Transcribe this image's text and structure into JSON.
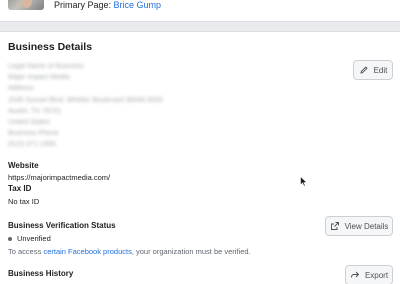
{
  "top": {
    "primary_page_label": "Primary Page:",
    "primary_page_name": "Brice Gump"
  },
  "business_details": {
    "title": "Business Details",
    "edit_label": "Edit",
    "redacted_lines": [
      "Legal Name of Business",
      "Major Impact Media",
      "Address",
      "2035 Sunset Blvd, Whittier Boulevard 90040 8000",
      "Austin, TX 78701",
      "United States",
      "Business Phone",
      "(512) 371-1665"
    ],
    "website_label": "Website",
    "website_value": "https://majorimpactmedia.com/",
    "tax_id_label": "Tax ID",
    "tax_id_value": "No tax ID"
  },
  "verification": {
    "title": "Business Verification Status",
    "status": "Unverified",
    "view_details_label": "View Details",
    "note_prefix": "To access ",
    "note_link": "certain Facebook products",
    "note_suffix": ", your organization must be verified."
  },
  "history": {
    "title": "Business History",
    "export_label": "Export"
  },
  "icons": {
    "edit": "pencil-icon",
    "view_details": "external-link-icon",
    "export": "export-icon"
  },
  "colors": {
    "link": "#216fdb",
    "background": "#e9ebee",
    "card": "#ffffff"
  }
}
